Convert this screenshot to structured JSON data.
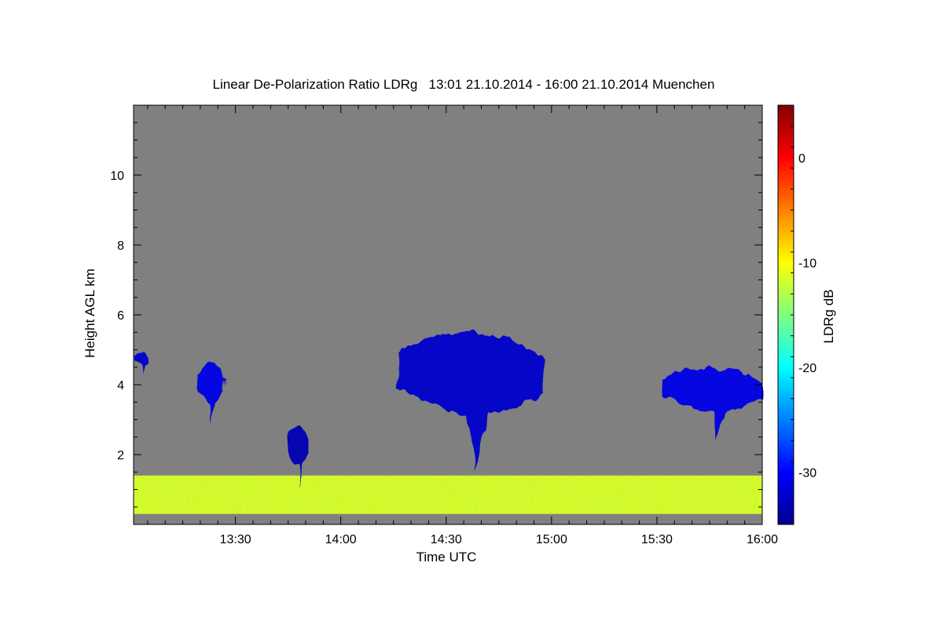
{
  "chart_data": {
    "type": "heatmap",
    "title": "Linear De-Polarization Ratio LDRg   13:01 21.10.2014 - 16:00 21.10.2014 Muenchen",
    "xlabel": "Time UTC",
    "ylabel": "Height AGL km",
    "colorbar_label": "LDRg dB",
    "x_range": [
      "13:01",
      "16:00"
    ],
    "x_ticks": [
      "13:30",
      "14:00",
      "14:30",
      "15:00",
      "15:30",
      "16:00"
    ],
    "y_range": [
      0,
      12
    ],
    "y_ticks": [
      2,
      4,
      6,
      8,
      10
    ],
    "colorbar_range": [
      -35,
      5
    ],
    "colorbar_ticks": [
      0,
      -10,
      -20,
      -30
    ],
    "background_color": "#808080",
    "colormap": "jet",
    "features": [
      {
        "kind": "boundary-layer aerosol",
        "t_start": "13:01",
        "t_end": "16:00",
        "h_bottom": 0.3,
        "h_top": 1.4,
        "ldr_db": -12
      },
      {
        "kind": "cloud",
        "t_start": "13:01",
        "t_end": "13:05",
        "h_bottom": 4.3,
        "h_top": 4.9,
        "ldr_db": -32
      },
      {
        "kind": "cloud",
        "t_start": "13:19",
        "t_end": "13:27",
        "h_bottom": 2.8,
        "h_top": 4.6,
        "ldr_db": -31
      },
      {
        "kind": "cloud",
        "t_start": "13:45",
        "t_end": "13:51",
        "h_bottom": 1.0,
        "h_top": 2.8,
        "ldr_db": -33
      },
      {
        "kind": "cloud",
        "t_start": "14:16",
        "t_end": "14:58",
        "h_bottom": 1.6,
        "h_top": 5.5,
        "ldr_db": -32
      },
      {
        "kind": "cloud",
        "t_start": "15:32",
        "t_end": "16:00",
        "h_bottom": 2.4,
        "h_top": 4.5,
        "ldr_db": -31
      }
    ]
  }
}
